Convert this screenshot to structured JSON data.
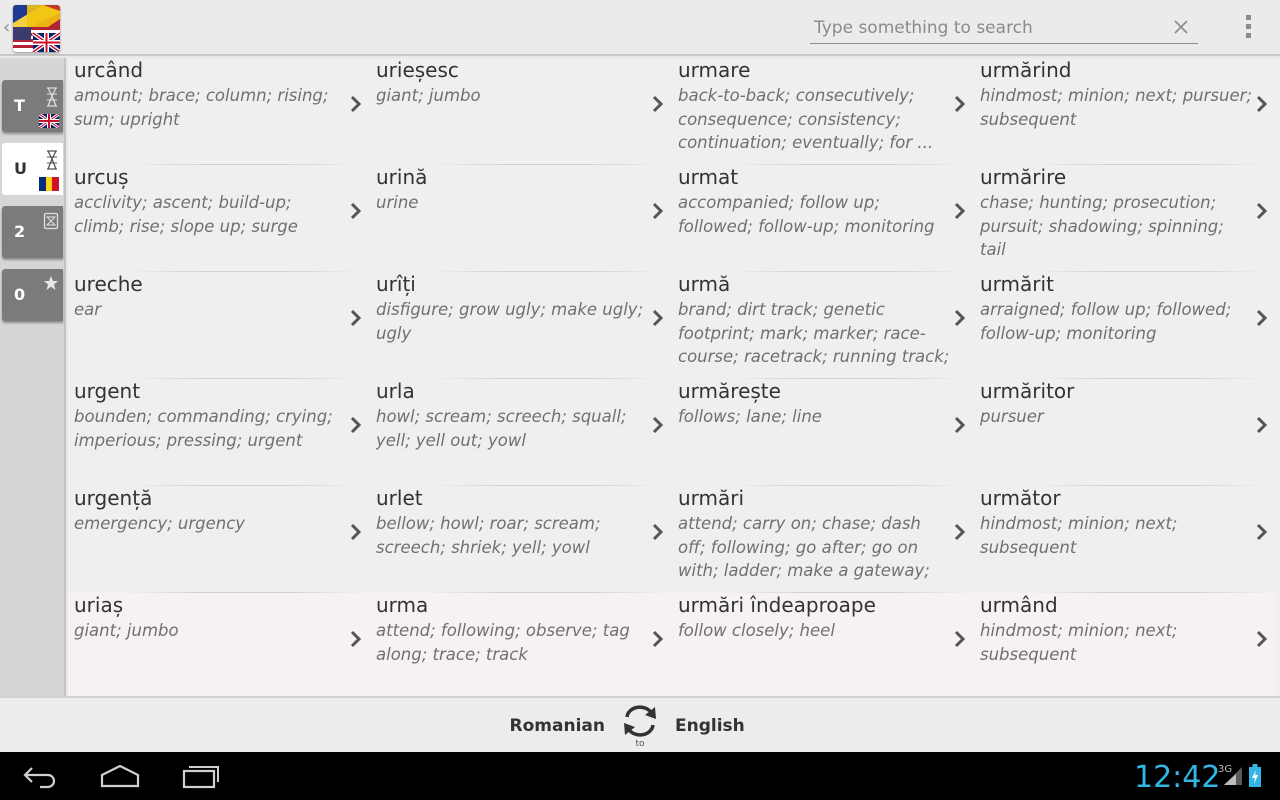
{
  "search": {
    "placeholder": "Type something to search"
  },
  "rail": {
    "tabs": [
      {
        "letter": "T",
        "icon": "hourglass-icon",
        "flag": "uk-flag"
      },
      {
        "letter": "U",
        "icon": "hourglass-icon",
        "flag": "romania-flag",
        "active": true
      },
      {
        "letter": "2",
        "icon": "history-icon"
      },
      {
        "letter": "0",
        "icon": "star-icon"
      }
    ]
  },
  "entries": [
    [
      {
        "word": "urcând",
        "definition": "amount; brace; column; rising; sum; upright"
      },
      {
        "word": "urieșesc",
        "definition": "giant; jumbo"
      },
      {
        "word": "urmare",
        "definition": "back-to-back; consecutively; consequence; consistency; continuation; eventually; for ..."
      },
      {
        "word": "urmărind",
        "definition": "hindmost; minion; next; pursuer; subsequent"
      }
    ],
    [
      {
        "word": "urcuș",
        "definition": "acclivity; ascent; build-up; climb; rise; slope up; surge"
      },
      {
        "word": "urină",
        "definition": "urine"
      },
      {
        "word": "urmat",
        "definition": "accompanied; follow up; followed; follow-up; monitoring"
      },
      {
        "word": "urmărire",
        "definition": "chase; hunting; prosecution; pursuit; shadowing; spinning; tail"
      }
    ],
    [
      {
        "word": "ureche",
        "definition": "ear"
      },
      {
        "word": "urîți",
        "definition": "disfigure; grow ugly; make ugly; ugly"
      },
      {
        "word": "urmă",
        "definition": "brand; dirt track; genetic footprint; mark; marker; race-course; racetrack; running track; runway;"
      },
      {
        "word": "urmărit",
        "definition": "arraigned; follow up; followed; follow-up; monitoring"
      }
    ],
    [
      {
        "word": "urgent",
        "definition": "bounden; commanding; crying; imperious; pressing; urgent"
      },
      {
        "word": "urla",
        "definition": "howl; scream; screech; squall; yell; yell out; yowl"
      },
      {
        "word": "urmărește",
        "definition": "follows; lane; line"
      },
      {
        "word": "urmăritor",
        "definition": "pursuer"
      }
    ],
    [
      {
        "word": "urgență",
        "definition": "emergency; urgency"
      },
      {
        "word": "urlet",
        "definition": "bellow; howl; roar; scream; screech; shriek; yell; yowl"
      },
      {
        "word": "urmări",
        "definition": "attend; carry on; chase; dash off; following; go after; go on with; ladder; make a gateway; make a"
      },
      {
        "word": "următor",
        "definition": "hindmost; minion; next; subsequent"
      }
    ],
    [
      {
        "word": "uriaș",
        "definition": "giant; jumbo"
      },
      {
        "word": "urma",
        "definition": "attend; following; observe; tag along; trace; track"
      },
      {
        "word": "urmări îndeaproape",
        "definition": "follow closely; heel"
      },
      {
        "word": "urmând",
        "definition": "hindmost; minion; next; subsequent"
      }
    ]
  ],
  "languages": {
    "from": "Romanian",
    "to": "English",
    "to_word": "to"
  },
  "status": {
    "time": "12:42",
    "network": "3G"
  },
  "colors": {
    "clock": "#33b5e5",
    "rail_tab": "#7b7b7b",
    "highlight_row": "#f5f1f5"
  }
}
